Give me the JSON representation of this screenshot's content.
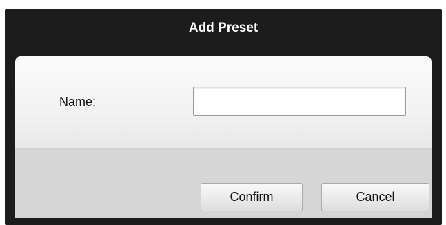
{
  "dialog": {
    "title": "Add Preset"
  },
  "form": {
    "name_label": "Name:",
    "name_value": "",
    "name_placeholder": ""
  },
  "buttons": {
    "confirm_label": "Confirm",
    "cancel_label": "Cancel"
  },
  "colors": {
    "title_bar": "#1c1c1c",
    "title_text": "#ffffff",
    "button_area": "#d6d6d6"
  }
}
